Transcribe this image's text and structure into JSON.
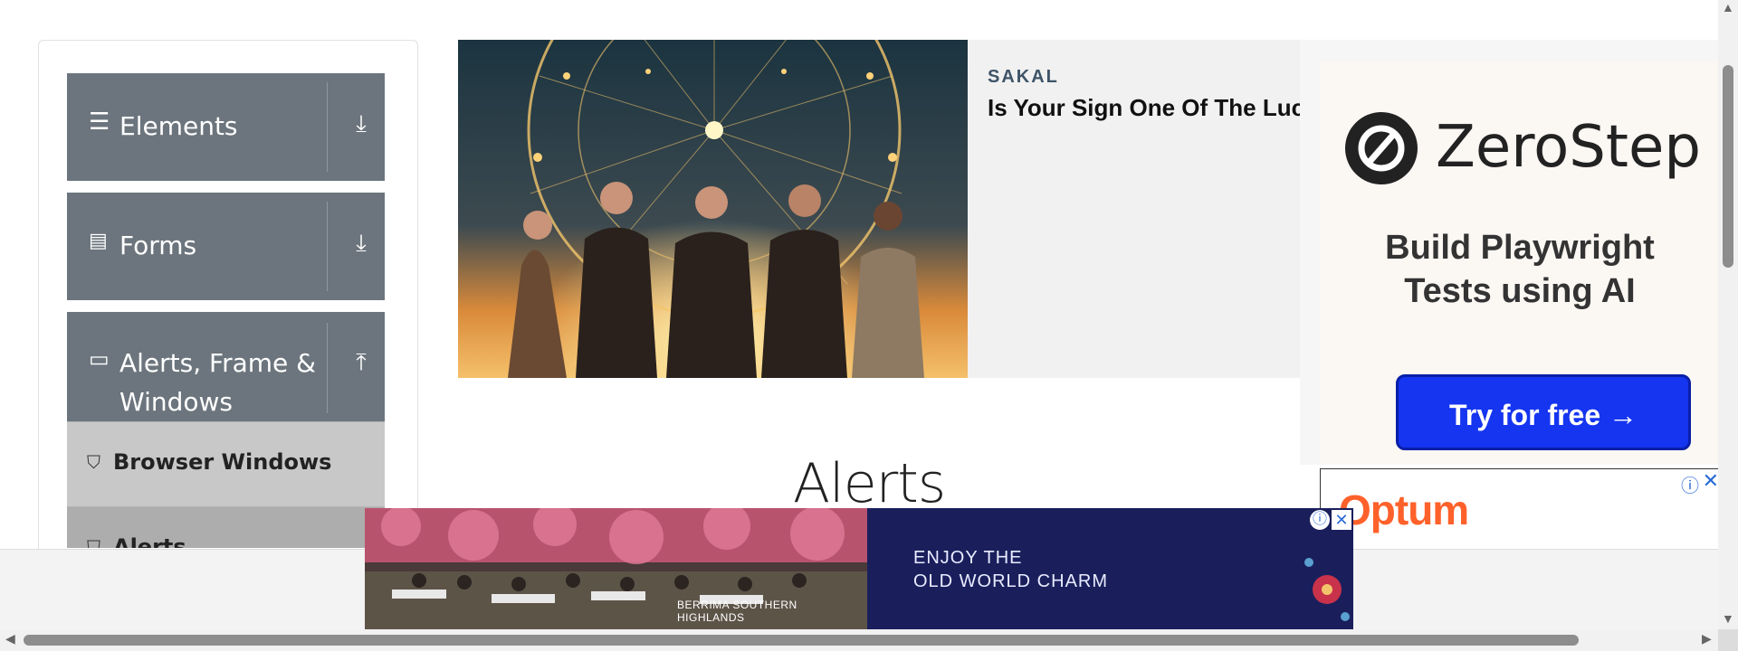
{
  "sidebar": {
    "groups": [
      {
        "label": "Elements",
        "icon": "hamburger-icon",
        "arrow": "download-icon"
      },
      {
        "label": "Forms",
        "icon": "document-icon",
        "arrow": "download-icon"
      },
      {
        "label": "Alerts, Frame &",
        "label2": "Windows",
        "icon": "window-icon",
        "arrow": "upload-icon"
      }
    ],
    "sub_items": [
      {
        "label": "Browser Windows",
        "icon": "html5-icon"
      },
      {
        "label": "Alerts",
        "icon": "html5-icon"
      }
    ]
  },
  "news_ad": {
    "source": "SAKAL",
    "headline": "Is Your Sign One Of The Luckiest?"
  },
  "zerostep_ad": {
    "brand": "ZeroStep",
    "headline_line1": "Build Playwright",
    "headline_line2": "Tests using AI",
    "button": "Try for free →"
  },
  "optum_ad": {
    "brand": "Optum"
  },
  "page": {
    "title": "Alerts"
  },
  "bottom_ad": {
    "caption": "BERRIMA SOUTHERN HIGHLANDS",
    "line1": "ENJOY THE",
    "line2": "OLD WORLD CHARM"
  },
  "colors": {
    "group_bg": "#6c757d",
    "sub_item_bg": "#c8c8c8",
    "zerostep_button": "#1535f0",
    "optum_orange": "#ff612b",
    "bottom_ad_bg": "#1a1f5c"
  }
}
